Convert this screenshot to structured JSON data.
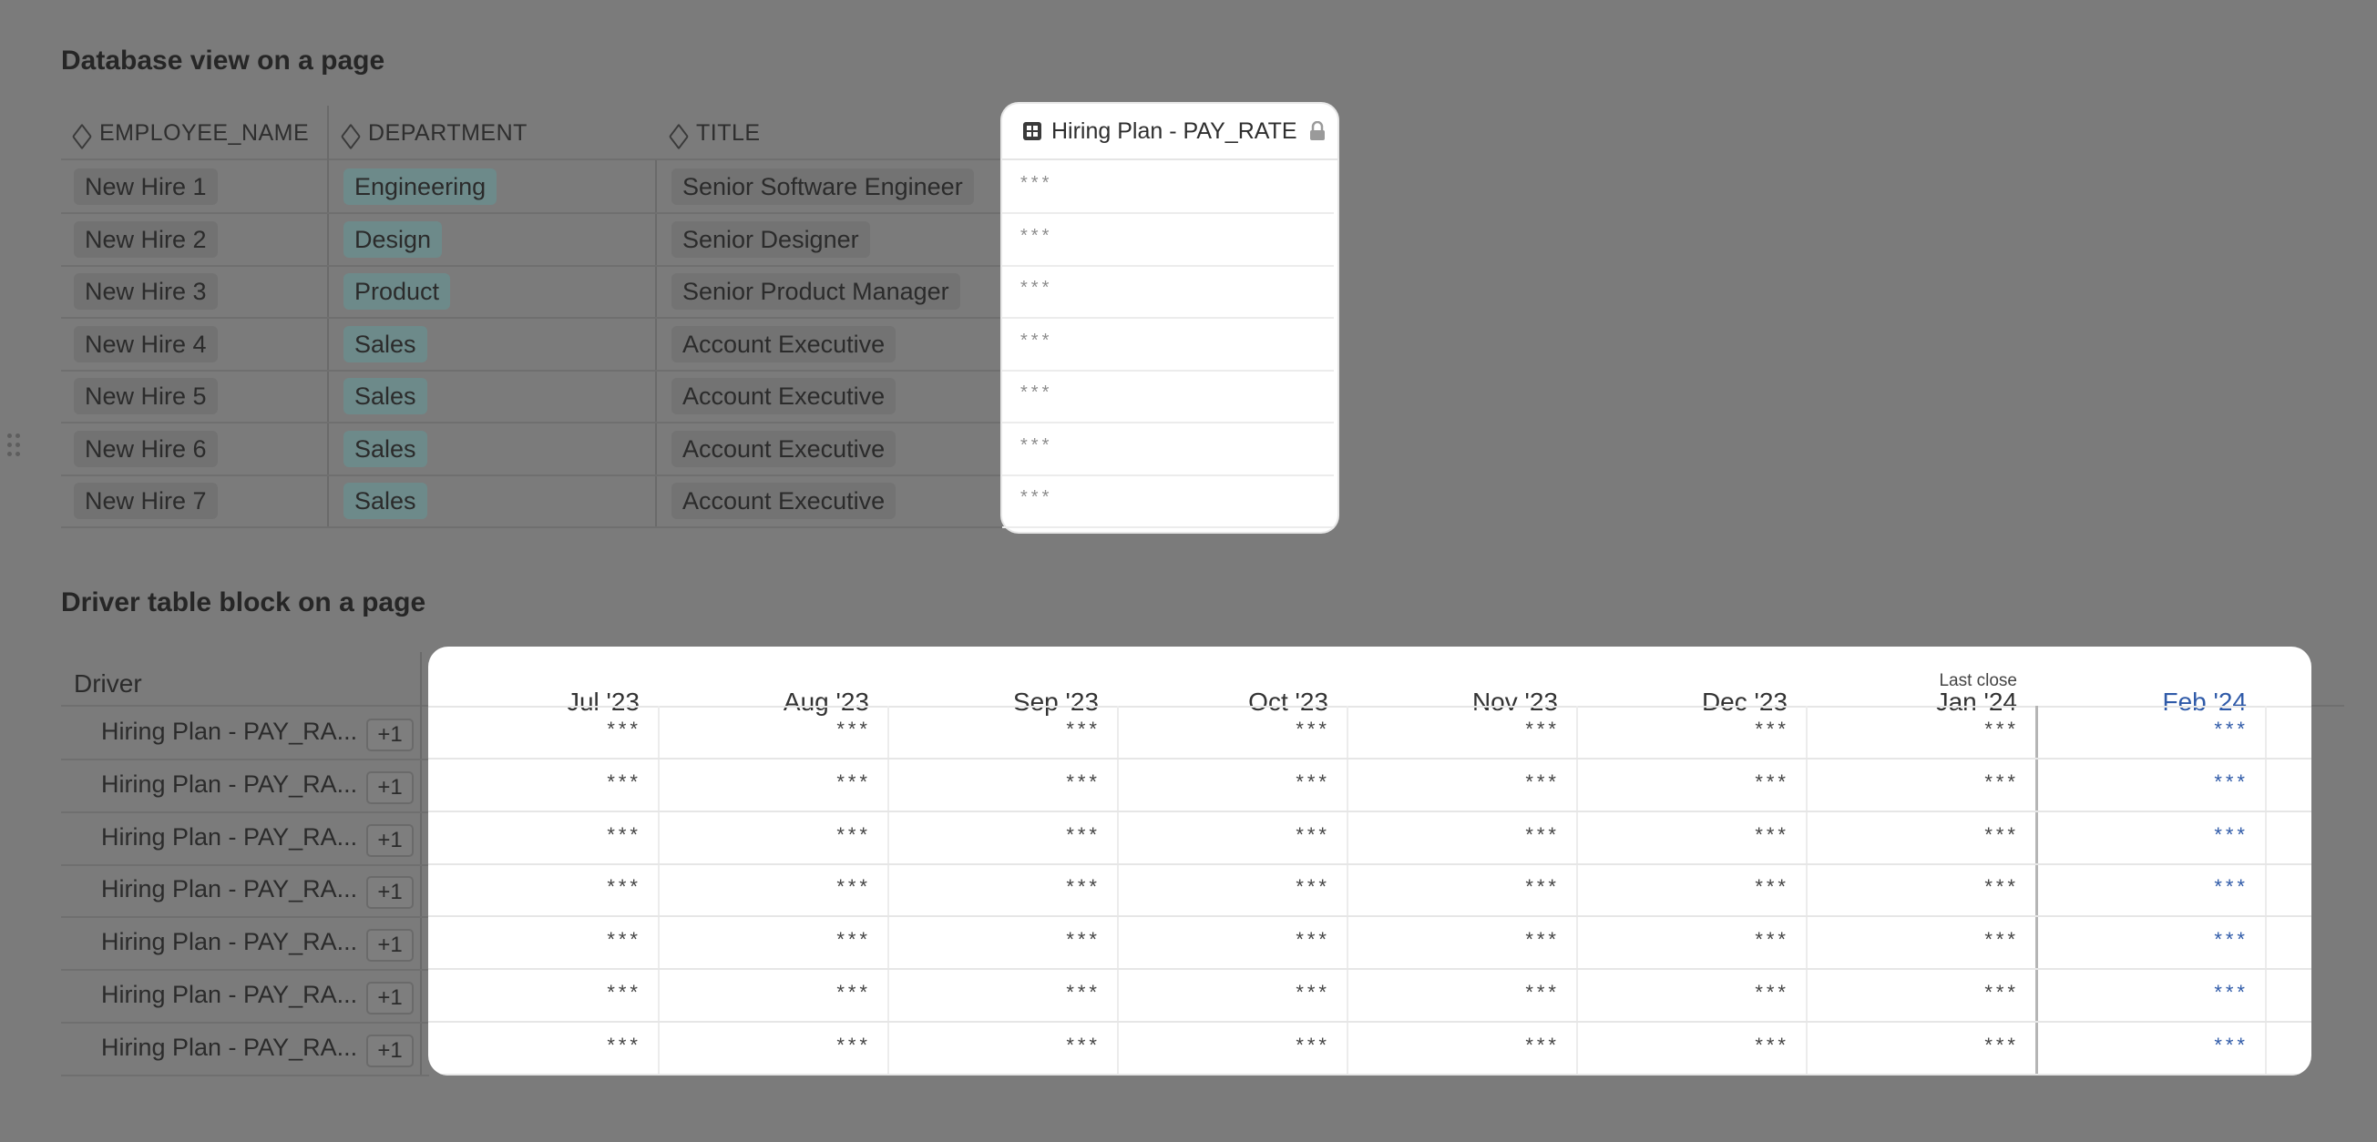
{
  "database_view": {
    "title": "Database view on a page",
    "columns": [
      "EMPLOYEE_NAME",
      "DEPARTMENT",
      "TITLE"
    ],
    "pay_column": "Hiring Plan - PAY_RATE",
    "rows": [
      {
        "name": "New Hire 1",
        "dept": "Engineering",
        "title": "Senior Software Engineer",
        "pay": "***"
      },
      {
        "name": "New Hire 2",
        "dept": "Design",
        "title": "Senior Designer",
        "pay": "***"
      },
      {
        "name": "New Hire 3",
        "dept": "Product",
        "title": "Senior Product Manager",
        "pay": "***"
      },
      {
        "name": "New Hire 4",
        "dept": "Sales",
        "title": "Account Executive",
        "pay": "***"
      },
      {
        "name": "New Hire 5",
        "dept": "Sales",
        "title": "Account Executive",
        "pay": "***"
      },
      {
        "name": "New Hire 6",
        "dept": "Sales",
        "title": "Account Executive",
        "pay": "***"
      },
      {
        "name": "New Hire 7",
        "dept": "Sales",
        "title": "Account Executive",
        "pay": "***"
      }
    ]
  },
  "driver_table": {
    "title": "Driver table block on a page",
    "driver_header": "Driver",
    "last_close_label": "Last close",
    "months": [
      "Jul '23",
      "Aug '23",
      "Sep '23",
      "Oct '23",
      "Nov '23",
      "Dec '23",
      "Jan '24",
      "Feb '24"
    ],
    "rows": [
      {
        "label": "Hiring Plan - PAY_RA...",
        "badge": "+1",
        "values": [
          "***",
          "***",
          "***",
          "***",
          "***",
          "***",
          "***",
          "***"
        ]
      },
      {
        "label": "Hiring Plan - PAY_RA...",
        "badge": "+1",
        "values": [
          "***",
          "***",
          "***",
          "***",
          "***",
          "***",
          "***",
          "***"
        ]
      },
      {
        "label": "Hiring Plan - PAY_RA...",
        "badge": "+1",
        "values": [
          "***",
          "***",
          "***",
          "***",
          "***",
          "***",
          "***",
          "***"
        ]
      },
      {
        "label": "Hiring Plan - PAY_RA...",
        "badge": "+1",
        "values": [
          "***",
          "***",
          "***",
          "***",
          "***",
          "***",
          "***",
          "***"
        ]
      },
      {
        "label": "Hiring Plan - PAY_RA...",
        "badge": "+1",
        "values": [
          "***",
          "***",
          "***",
          "***",
          "***",
          "***",
          "***",
          "***"
        ]
      },
      {
        "label": "Hiring Plan - PAY_RA...",
        "badge": "+1",
        "values": [
          "***",
          "***",
          "***",
          "***",
          "***",
          "***",
          "***",
          "***"
        ]
      },
      {
        "label": "Hiring Plan - PAY_RA...",
        "badge": "+1",
        "values": [
          "***",
          "***",
          "***",
          "***",
          "***",
          "***",
          "***",
          "***"
        ]
      }
    ]
  },
  "colors": {
    "background": "#7b7b7b",
    "department_chip": "#6d8a8a",
    "future_value": "#2f5aa8",
    "card": "#ffffff"
  }
}
